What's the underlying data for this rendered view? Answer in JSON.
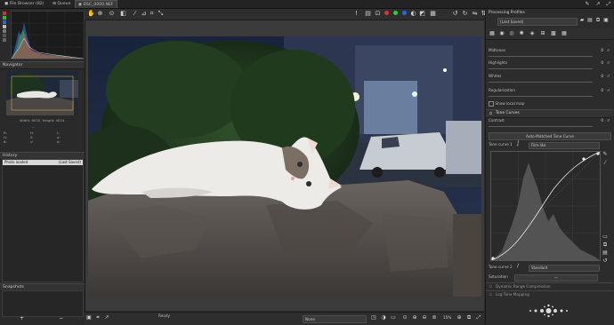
{
  "tabs": [
    {
      "label": "File Browser (82)"
    },
    {
      "label": "Queue"
    },
    {
      "label": "DSC_0000.NEF"
    }
  ],
  "navigator": {
    "title": "Navigator",
    "size_text": "Width: 6032, Height: 4024",
    "readout_left": [
      "R:",
      "G:",
      "B:"
    ],
    "readout_mid": [
      "H:",
      "S:",
      "V:"
    ],
    "readout_right": [
      "L:",
      "a:",
      "b:"
    ],
    "dash": "--"
  },
  "history": {
    "title": "History",
    "col_left": "Photo loaded",
    "col_right": "(Last Saved)"
  },
  "snapshots": {
    "title": "Snapshots",
    "add": "+",
    "remove": "−"
  },
  "status": {
    "ready": "Ready",
    "select_value": "None",
    "zoom": "15%"
  },
  "right": {
    "processing_profiles": "Processing Profiles",
    "profile_value": "(Last Saved)",
    "sliders": [
      {
        "label": "Midtones",
        "value": "0"
      },
      {
        "label": "Highlights",
        "value": "0"
      },
      {
        "label": "Whites",
        "value": "0"
      },
      {
        "label": "Regularization",
        "value": "0"
      }
    ],
    "show_local_map": "Show local map",
    "tone_curves": "Tone Curves",
    "contrast": {
      "label": "Contrast",
      "value": "0"
    },
    "auto_matched": "Auto-Matched Tone Curve",
    "tone_curve_1": {
      "label": "Tone curve 1",
      "value": "Film-like"
    },
    "tone_curve_2": {
      "label": "Tone curve 2",
      "value": "Standard"
    },
    "saturation": {
      "label": "Saturation",
      "value": "—"
    },
    "dynamic_range": "Dynamic Range Compression",
    "log_tone": "Log Tone Mapping"
  },
  "icons": {
    "top_right": [
      "pencil-icon",
      "arrow-icon",
      "expand-icon"
    ],
    "toolbar": [
      "hand-icon",
      "zoom-icon",
      "spot-icon",
      "picker-icon",
      "straighten-icon",
      "crop-icon",
      "transform-icon"
    ]
  }
}
